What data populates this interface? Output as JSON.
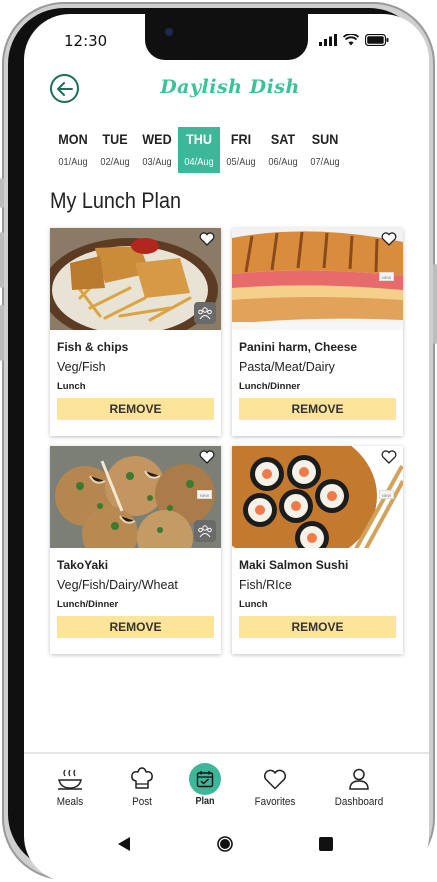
{
  "status_bar": {
    "time": "12:30"
  },
  "header": {
    "logo_text": "Daylish Dish"
  },
  "days": [
    {
      "name": "MON",
      "date": "01/Aug",
      "active": false
    },
    {
      "name": "TUE",
      "date": "02/Aug",
      "active": false
    },
    {
      "name": "WED",
      "date": "03/Aug",
      "active": false
    },
    {
      "name": "THU",
      "date": "04/Aug",
      "active": true
    },
    {
      "name": "FRI",
      "date": "05/Aug",
      "active": false
    },
    {
      "name": "SAT",
      "date": "06/Aug",
      "active": false
    },
    {
      "name": "SUN",
      "date": "07/Aug",
      "active": false
    }
  ],
  "plan_title": "My Lunch Plan",
  "cards": [
    {
      "name": "Fish & chips",
      "category": "Veg/Fish",
      "meal": "Lunch",
      "remove_label": "REMOVE",
      "badge": "group"
    },
    {
      "name": "Panini harm, Cheese",
      "category": "Pasta/Meat/Dairy",
      "meal": "Lunch/Dinner",
      "remove_label": "REMOVE",
      "badge": "new"
    },
    {
      "name": "TakoYaki",
      "category": "Veg/Fish/Dairy/Wheat",
      "meal": "Lunch/Dinner",
      "remove_label": "REMOVE",
      "badge": "group+new"
    },
    {
      "name": "Maki Salmon Sushi",
      "category": "Fish/RIce",
      "meal": "Lunch",
      "remove_label": "REMOVE",
      "badge": "new"
    }
  ],
  "new_badge_text": "NEW",
  "tabs": [
    {
      "label": "Meals",
      "icon": "bowl-icon"
    },
    {
      "label": "Post",
      "icon": "chef-hat-icon"
    },
    {
      "label": "Plan",
      "icon": "calendar-icon",
      "active": true
    },
    {
      "label": "Favorites",
      "icon": "heart-icon"
    },
    {
      "label": "Dashboard",
      "icon": "user-icon"
    }
  ],
  "colors": {
    "accent": "#3cb79a",
    "logo": "#3cc29a",
    "remove_bg": "#fce49a",
    "back_ring": "#1f6e57"
  }
}
